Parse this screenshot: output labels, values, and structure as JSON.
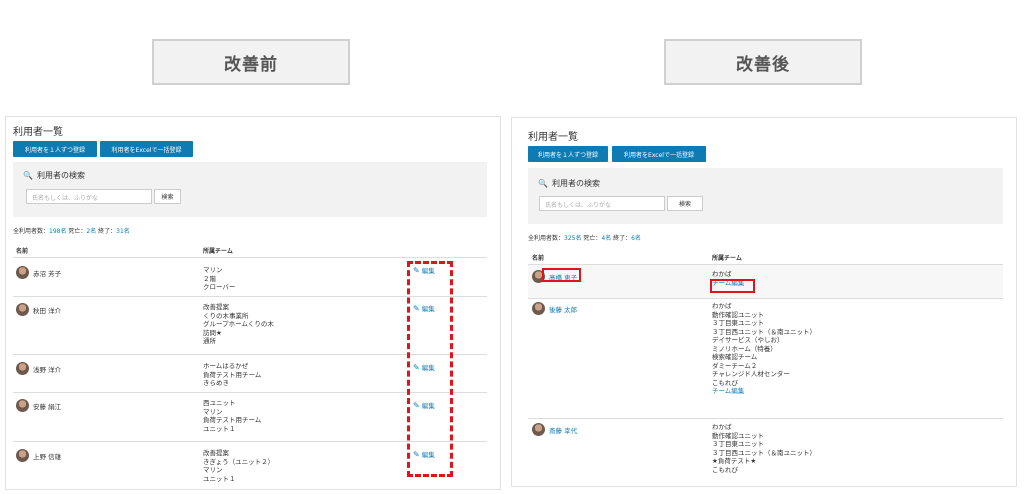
{
  "labels": {
    "before": "改善前",
    "after": "改善後"
  },
  "before": {
    "title": "利用者一覧",
    "buttons": [
      "利用者を１人ずつ登録",
      "利用者をExcelで一括登録"
    ],
    "search": {
      "heading": "利用者の検索",
      "placeholder": "氏名もしくは、ふりがな",
      "button": "検索"
    },
    "counts": {
      "total_label": "全利用者数：",
      "total": "198名",
      "dead_label": "死亡：",
      "dead": "2名",
      "ended_label": "終了：",
      "ended": "31名"
    },
    "headers": {
      "name": "名前",
      "team": "所属チーム"
    },
    "rows": [
      {
        "name": "赤沼 芳子",
        "teams": [
          "マリン",
          "２階",
          "クローバー"
        ],
        "edit": "編集"
      },
      {
        "name": "秋田 洋介",
        "teams": [
          "改善提案",
          "くりの木事業所",
          "グループホームくりの木",
          "訪問★",
          "通所"
        ],
        "edit": "編集"
      },
      {
        "name": "浅野 洋介",
        "teams": [
          "ホームはるかぜ",
          "負荷テスト用チーム",
          "きらめき"
        ],
        "edit": "編集"
      },
      {
        "name": "安藤 絹江",
        "teams": [
          "西ユニット",
          "マリン",
          "負荷テスト用チーム",
          "ユニット１"
        ],
        "edit": "編集"
      },
      {
        "name": "上野 信雄",
        "teams": [
          "改善提案",
          "きぎょう（ユニット２）",
          "マリン",
          "ユニット１"
        ],
        "edit": "編集"
      }
    ]
  },
  "after": {
    "title": "利用者一覧",
    "buttons": [
      "利用者を１人ずつ登録",
      "利用者をExcelで一括登録"
    ],
    "search": {
      "heading": "利用者の検索",
      "placeholder": "氏名もしくは、ふりがな",
      "button": "検索"
    },
    "counts": {
      "total_label": "全利用者数：",
      "total": "325名",
      "dead_label": "死亡：",
      "dead": "4名",
      "ended_label": "終了：",
      "ended": "6名"
    },
    "headers": {
      "name": "名前",
      "team": "所属チーム"
    },
    "rows": [
      {
        "name": "髙橋 恵子",
        "teams": [
          "わかば"
        ],
        "team_edit": "チーム編集"
      },
      {
        "name": "後藤 太郎",
        "teams": [
          "わかば",
          "動作確認ユニット",
          "３丁目東ユニット",
          "３丁目西ユニット（＆南ユニット）",
          "デイサービス（やしお）",
          "ミノリホーム（特養）",
          "検索確認チーム",
          "ダミーチーム２",
          "チャレンジド人材センター",
          "こもれび"
        ],
        "team_edit": "チーム編集"
      },
      {
        "name": "斎藤 幸代",
        "teams": [
          "わかば",
          "動作確認ユニット",
          "３丁目東ユニット",
          "３丁目西ユニット（＆南ユニット）",
          "★負荷テスト★",
          "こもれび"
        ]
      }
    ]
  },
  "colors": {
    "accent": "#0f7bb3",
    "highlight": "#e0151b"
  }
}
